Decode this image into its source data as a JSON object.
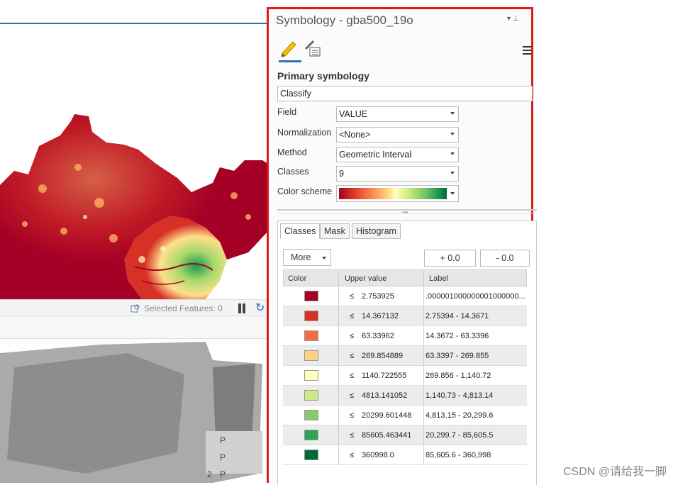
{
  "map": {
    "status": {
      "selected_features": "Selected Features: 0"
    }
  },
  "table": {
    "cells": [
      "P",
      "P",
      "2",
      "P"
    ]
  },
  "symbology": {
    "title": "Symbology - gba500_19o",
    "section_title": "Primary symbology",
    "method_dropdown": "Classify",
    "properties": [
      {
        "label": "Field",
        "value": "VALUE"
      },
      {
        "label": "Normalization",
        "value": "<None>"
      },
      {
        "label": "Method",
        "value": "Geometric Interval"
      },
      {
        "label": "Classes",
        "value": "9"
      },
      {
        "label": "Color scheme",
        "value": ""
      }
    ],
    "tabs": [
      {
        "label": "Classes",
        "active": true
      },
      {
        "label": "Mask",
        "active": false
      },
      {
        "label": "Histogram",
        "active": false
      }
    ],
    "more_label": "More",
    "plus_label": "+ 0.0",
    "minus_label": "- 0.0",
    "columns": [
      "Color",
      "Upper value",
      "Label"
    ],
    "rows": [
      {
        "color": "#a50026",
        "le": "≤",
        "upper": "2.753925",
        "label": ".000001000000001000000..."
      },
      {
        "color": "#d73027",
        "le": "≤",
        "upper": "14.367132",
        "label": "2.75394 - 14.3671"
      },
      {
        "color": "#f46d43",
        "le": "≤",
        "upper": "63.33962",
        "label": "14.3672 - 63.3396"
      },
      {
        "color": "#fdd283",
        "le": "≤",
        "upper": "269.854889",
        "label": "63.3397 - 269.855"
      },
      {
        "color": "#ffffbf",
        "le": "≤",
        "upper": "1140.722555",
        "label": "269.856 - 1,140.72"
      },
      {
        "color": "#cfe88a",
        "le": "≤",
        "upper": "4813.141052",
        "label": "1,140.73 - 4,813.14"
      },
      {
        "color": "#8bc96b",
        "le": "≤",
        "upper": "20299.601448",
        "label": "4,813.15 - 20,299.6"
      },
      {
        "color": "#2fa457",
        "le": "≤",
        "upper": "85605.463441",
        "label": "20,299.7 - 85,605.5"
      },
      {
        "color": "#006837",
        "le": "≤",
        "upper": "360998.0",
        "label": "85,605.6 - 360,998"
      }
    ]
  },
  "watermark": "CSDN @请给我一脚"
}
